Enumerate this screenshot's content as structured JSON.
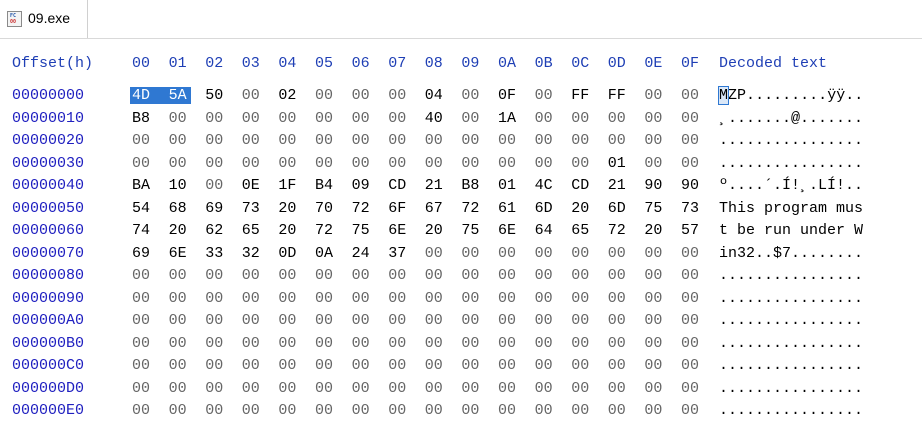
{
  "tab": {
    "label": "09.exe",
    "icon": "exe-file-icon",
    "icon_text_top": "FC",
    "icon_text_bottom": "00"
  },
  "header": {
    "offset_label": "Offset(h)",
    "columns": [
      "00",
      "01",
      "02",
      "03",
      "04",
      "05",
      "06",
      "07",
      "08",
      "09",
      "0A",
      "0B",
      "0C",
      "0D",
      "0E",
      "0F"
    ],
    "decoded_label": "Decoded text"
  },
  "colors": {
    "offset": "#2020c0",
    "header": "#1f3fb5",
    "selection": "#2f78d2",
    "zero_byte": "#666666",
    "nonzero_byte": "#000000"
  },
  "selection": {
    "row": 0,
    "bytes": [
      0,
      1
    ],
    "decoded_chars": [
      0
    ]
  },
  "rows": [
    {
      "offset": "00000000",
      "bytes": [
        "4D",
        "5A",
        "50",
        "00",
        "02",
        "00",
        "00",
        "00",
        "04",
        "00",
        "0F",
        "00",
        "FF",
        "FF",
        "00",
        "00"
      ],
      "decoded": "MZP.........ÿÿ.."
    },
    {
      "offset": "00000010",
      "bytes": [
        "B8",
        "00",
        "00",
        "00",
        "00",
        "00",
        "00",
        "00",
        "40",
        "00",
        "1A",
        "00",
        "00",
        "00",
        "00",
        "00"
      ],
      "decoded": "¸.......@......."
    },
    {
      "offset": "00000020",
      "bytes": [
        "00",
        "00",
        "00",
        "00",
        "00",
        "00",
        "00",
        "00",
        "00",
        "00",
        "00",
        "00",
        "00",
        "00",
        "00",
        "00"
      ],
      "decoded": "................"
    },
    {
      "offset": "00000030",
      "bytes": [
        "00",
        "00",
        "00",
        "00",
        "00",
        "00",
        "00",
        "00",
        "00",
        "00",
        "00",
        "00",
        "00",
        "01",
        "00",
        "00"
      ],
      "decoded": "................"
    },
    {
      "offset": "00000040",
      "bytes": [
        "BA",
        "10",
        "00",
        "0E",
        "1F",
        "B4",
        "09",
        "CD",
        "21",
        "B8",
        "01",
        "4C",
        "CD",
        "21",
        "90",
        "90"
      ],
      "decoded": "º....´.Í!¸.LÍ!.."
    },
    {
      "offset": "00000050",
      "bytes": [
        "54",
        "68",
        "69",
        "73",
        "20",
        "70",
        "72",
        "6F",
        "67",
        "72",
        "61",
        "6D",
        "20",
        "6D",
        "75",
        "73"
      ],
      "decoded": "This program mus"
    },
    {
      "offset": "00000060",
      "bytes": [
        "74",
        "20",
        "62",
        "65",
        "20",
        "72",
        "75",
        "6E",
        "20",
        "75",
        "6E",
        "64",
        "65",
        "72",
        "20",
        "57"
      ],
      "decoded": "t be run under W"
    },
    {
      "offset": "00000070",
      "bytes": [
        "69",
        "6E",
        "33",
        "32",
        "0D",
        "0A",
        "24",
        "37",
        "00",
        "00",
        "00",
        "00",
        "00",
        "00",
        "00",
        "00"
      ],
      "decoded": "in32..$7........"
    },
    {
      "offset": "00000080",
      "bytes": [
        "00",
        "00",
        "00",
        "00",
        "00",
        "00",
        "00",
        "00",
        "00",
        "00",
        "00",
        "00",
        "00",
        "00",
        "00",
        "00"
      ],
      "decoded": "................"
    },
    {
      "offset": "00000090",
      "bytes": [
        "00",
        "00",
        "00",
        "00",
        "00",
        "00",
        "00",
        "00",
        "00",
        "00",
        "00",
        "00",
        "00",
        "00",
        "00",
        "00"
      ],
      "decoded": "................"
    },
    {
      "offset": "000000A0",
      "bytes": [
        "00",
        "00",
        "00",
        "00",
        "00",
        "00",
        "00",
        "00",
        "00",
        "00",
        "00",
        "00",
        "00",
        "00",
        "00",
        "00"
      ],
      "decoded": "................"
    },
    {
      "offset": "000000B0",
      "bytes": [
        "00",
        "00",
        "00",
        "00",
        "00",
        "00",
        "00",
        "00",
        "00",
        "00",
        "00",
        "00",
        "00",
        "00",
        "00",
        "00"
      ],
      "decoded": "................"
    },
    {
      "offset": "000000C0",
      "bytes": [
        "00",
        "00",
        "00",
        "00",
        "00",
        "00",
        "00",
        "00",
        "00",
        "00",
        "00",
        "00",
        "00",
        "00",
        "00",
        "00"
      ],
      "decoded": "................"
    },
    {
      "offset": "000000D0",
      "bytes": [
        "00",
        "00",
        "00",
        "00",
        "00",
        "00",
        "00",
        "00",
        "00",
        "00",
        "00",
        "00",
        "00",
        "00",
        "00",
        "00"
      ],
      "decoded": "................"
    },
    {
      "offset": "000000E0",
      "bytes": [
        "00",
        "00",
        "00",
        "00",
        "00",
        "00",
        "00",
        "00",
        "00",
        "00",
        "00",
        "00",
        "00",
        "00",
        "00",
        "00"
      ],
      "decoded": "................"
    }
  ]
}
